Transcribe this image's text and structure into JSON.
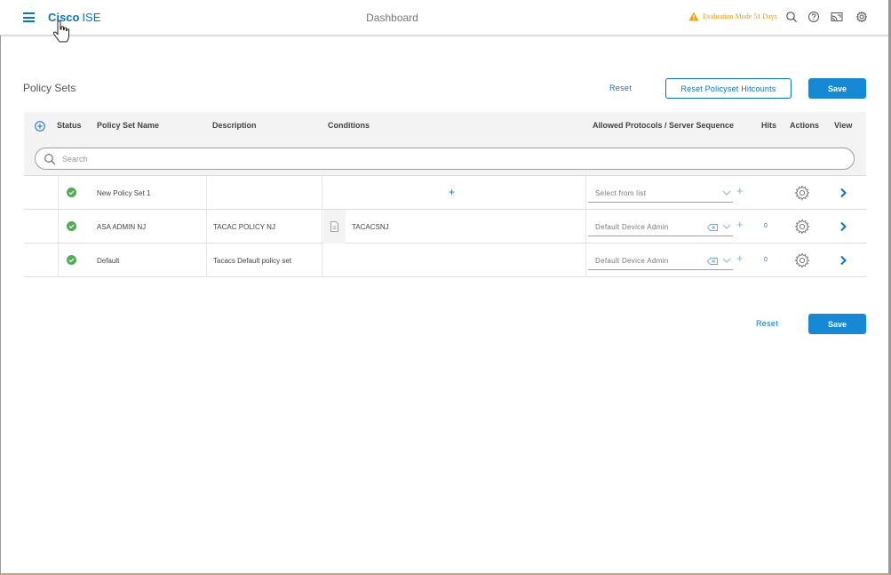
{
  "header": {
    "brand_bold": "Cisco",
    "brand_rest": "ISE",
    "page_name": "Dashboard",
    "eval_mode": "Evaluation Mode 51 Days",
    "icons": [
      "menu-icon",
      "search-icon",
      "help-icon",
      "cast-icon",
      "gear-icon"
    ]
  },
  "page": {
    "title": "Policy Sets",
    "reset_label": "Reset",
    "reset_hitcounts_label": "Reset Policyset Hitcounts",
    "save_label": "Save"
  },
  "table": {
    "columns": {
      "status": "Status",
      "name": "Policy Set Name",
      "description": "Description",
      "conditions": "Conditions",
      "protocols": "Allowed Protocols / Server Sequence",
      "hits": "Hits",
      "actions": "Actions",
      "view": "View"
    },
    "search_placeholder": "Search",
    "rows": [
      {
        "name": "New Policy Set 1",
        "description": "",
        "condition": "+",
        "protocol": "Select from list",
        "hits": ""
      },
      {
        "name": "ASA ADMIN NJ",
        "description": "TACAC POLICY NJ",
        "condition": "TACACSNJ",
        "protocol": "Default Device Admin",
        "hits": "0"
      },
      {
        "name": "Default",
        "description": "Tacacs Default policy set",
        "condition": "",
        "protocol": "Default Device Admin",
        "hits": "0"
      }
    ]
  },
  "footer": {
    "reset_label": "Reset",
    "save_label": "Save"
  },
  "colors": {
    "accent": "#0b74c4",
    "primary_button": "#1589d6",
    "status_ok": "#4caf50",
    "warning": "#e09a17"
  }
}
